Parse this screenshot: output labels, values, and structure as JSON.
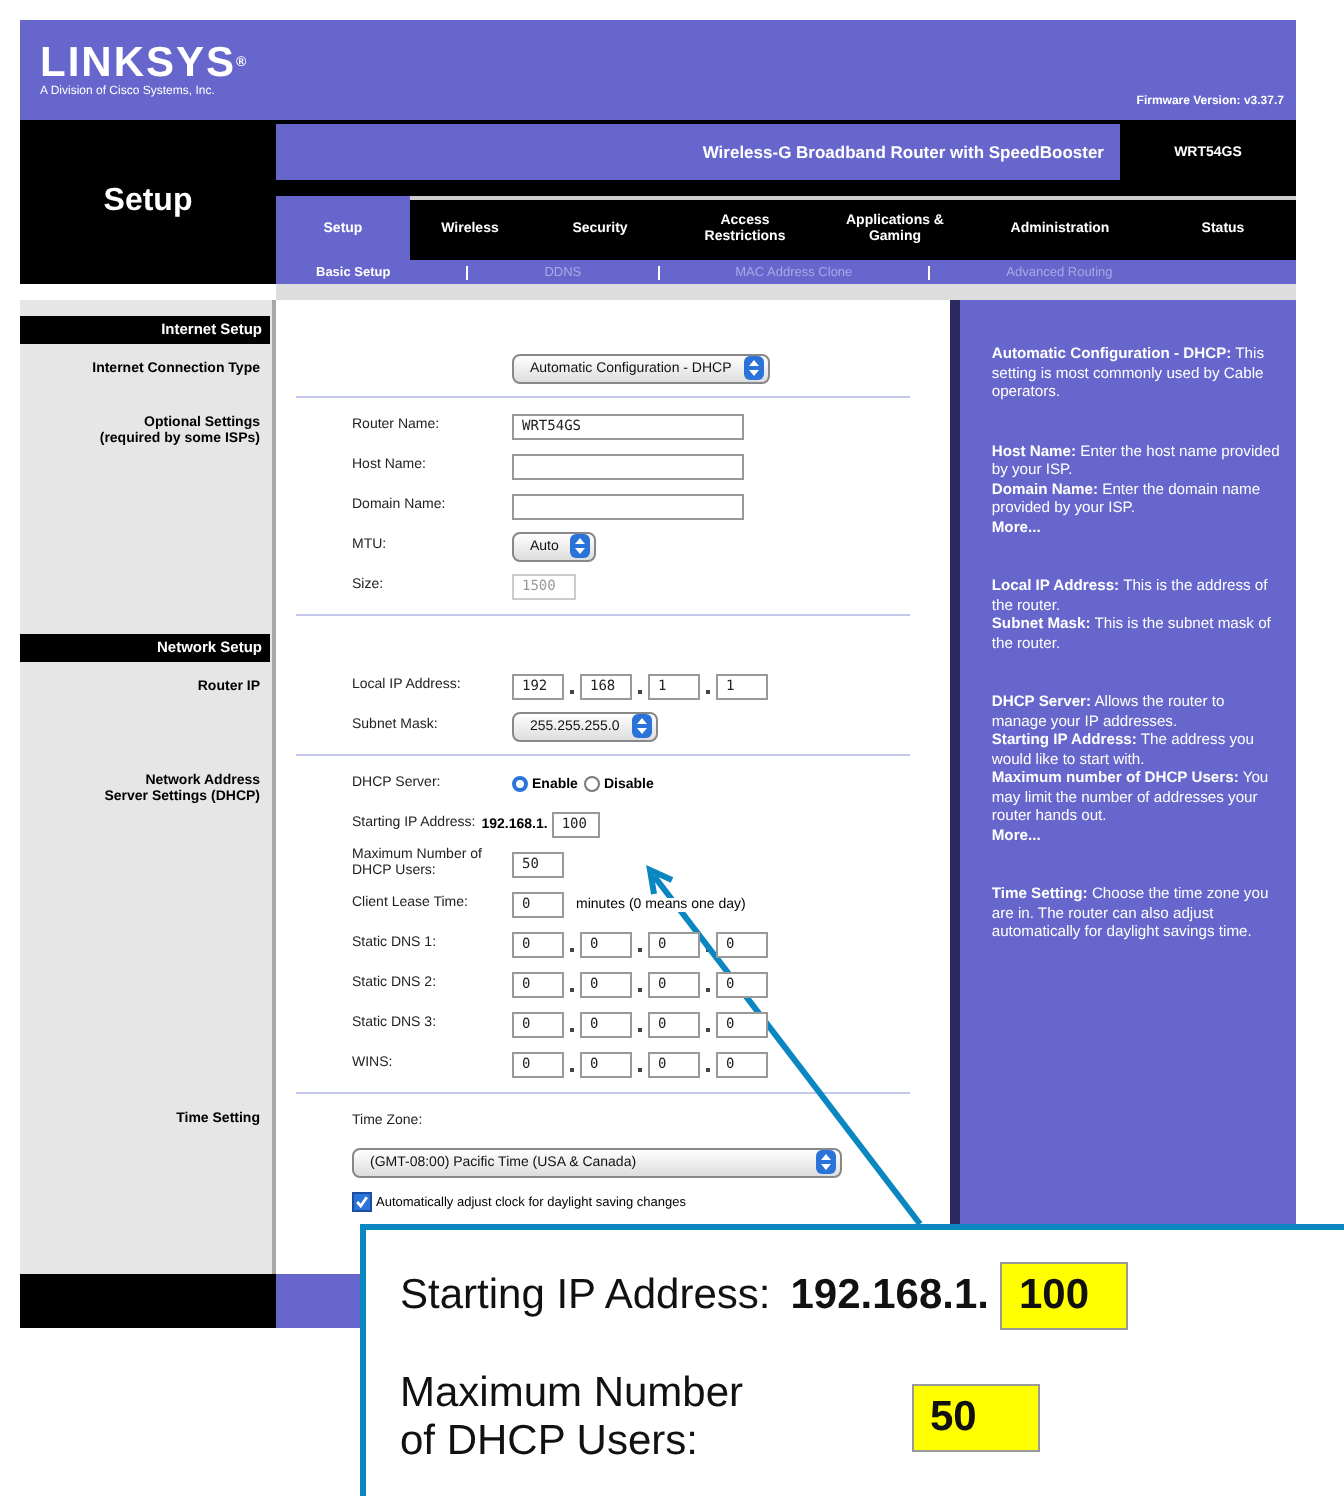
{
  "header": {
    "brand": "LINKSYS$^{®}$",
    "tagline": "A Division of Cisco Systems, Inc.",
    "firmware": "Firmware Version: v3.37.7"
  },
  "nav": {
    "page_title": "Setup",
    "product_title": "Wireless-G Broadband Router with SpeedBooster",
    "model": "WRT54GS",
    "tabs": [
      {
        "label": "Setup",
        "selected": true
      },
      {
        "label": "Wireless",
        "selected": false
      },
      {
        "label": "Security",
        "selected": false
      },
      {
        "label": "Access Restrictions",
        "selected": false
      },
      {
        "label": "Applications & Gaming",
        "selected": false
      },
      {
        "label": "Administration",
        "selected": false
      },
      {
        "label": "Status",
        "selected": false
      }
    ],
    "subtabs": [
      {
        "label": "Basic Setup",
        "selected": true
      },
      {
        "label": "DDNS",
        "selected": false
      },
      {
        "label": "MAC Address Clone",
        "selected": false
      },
      {
        "label": "Advanced Routing",
        "selected": false
      }
    ]
  },
  "sections": [
    {
      "title": "Internet Setup",
      "groups": [
        {
          "label": "Internet Connection Type",
          "rows": [
            {
              "kind": "select",
              "value": "Automatic Configuration - DHCP"
            }
          ]
        },
        {
          "label": "Optional Settings",
          "sublabel": "(required by some ISPs)",
          "rows": [
            {
              "kind": "text",
              "label": "Router Name:",
              "value": "WRT54GS"
            },
            {
              "kind": "text",
              "label": "Host Name:"
            },
            {
              "kind": "text",
              "label": "Domain Name:"
            },
            {
              "kind": "select",
              "label": "MTU:",
              "value": "Auto"
            },
            {
              "kind": "number",
              "label": "Size:",
              "value": "1500",
              "disabled": true
            }
          ]
        }
      ]
    },
    {
      "title": "Network Setup",
      "groups": [
        {
          "label": "Router IP",
          "rows": [
            {
              "kind": "ip",
              "label": "Local IP Address:",
              "octets": [
                "192",
                "168",
                "1",
                "1"
              ]
            },
            {
              "kind": "select",
              "label": "Subnet Mask:",
              "value": "255.255.255.0"
            }
          ]
        },
        {
          "label": "Network Address",
          "sublabel": "Server Settings (DHCP)",
          "rows": [
            {
              "kind": "radio",
              "label": "DHCP Server:",
              "options": [
                {
                  "label": "Enable",
                  "selected": true
                },
                {
                  "label": "Disable",
                  "selected": false
                }
              ]
            },
            {
              "kind": "prefix",
              "label": "Starting IP Address:",
              "prefix": "192.168.1.",
              "value": "100"
            },
            {
              "kind": "number",
              "label": "Maximum Number of DHCP Users:",
              "value": "50"
            },
            {
              "kind": "number",
              "label": "Client Lease Time:",
              "value": "0",
              "suffix": "minutes (0 means one day)"
            },
            {
              "kind": "ip",
              "label": "Static DNS 1:",
              "octets": [
                "0",
                "0",
                "0",
                "0"
              ]
            },
            {
              "kind": "ip",
              "label": "Static DNS 2:",
              "octets": [
                "0",
                "0",
                "0",
                "0"
              ]
            },
            {
              "kind": "ip",
              "label": "Static DNS 3:",
              "octets": [
                "0",
                "0",
                "0",
                "0"
              ]
            },
            {
              "kind": "ip",
              "label": "WINS:",
              "octets": [
                "0",
                "0",
                "0",
                "0"
              ]
            }
          ]
        },
        {
          "label": "Time Setting",
          "rows": [
            {
              "kind": "caption",
              "label": "Time Zone:"
            },
            {
              "kind": "select",
              "value": "(GMT-08:00) Pacific Time (USA & Canada)",
              "wide": true
            },
            {
              "kind": "checkbox",
              "label": "Automatically adjust clock for daylight saving changes",
              "checked": true
            }
          ]
        }
      ]
    }
  ],
  "help": [
    [
      {
        "kind": "text",
        "text": "**Automatic Configuration - DHCP:** This setting is most commonly used by Cable operators."
      }
    ],
    [
      {
        "kind": "text",
        "text": "**Host Name:** Enter the host name provided by your ISP."
      },
      {
        "kind": "text",
        "text": "**Domain Name:** Enter the domain name provided by your ISP."
      },
      {
        "kind": "link",
        "text": "More..."
      }
    ],
    [
      {
        "kind": "text",
        "text": "**Local IP Address:** This is the address of the router."
      },
      {
        "kind": "text",
        "text": "**Subnet Mask:** This is the subnet mask of the router."
      }
    ],
    [
      {
        "kind": "text",
        "text": "**DHCP Server:** Allows the router to manage your IP addresses."
      },
      {
        "kind": "text",
        "text": "**Starting IP Address:** The address you would like to start with."
      },
      {
        "kind": "text",
        "text": "**Maximum number of DHCP Users:** You may limit the number of addresses your router hands out."
      },
      {
        "kind": "link",
        "text": "More..."
      }
    ],
    [
      {
        "kind": "text",
        "text": "**Time Setting:** Choose the time zone you are in. The router can also adjust automatically for daylight savings time."
      }
    ]
  ],
  "callout": {
    "rows": [
      {
        "label": "Starting IP Address:",
        "prefix": "192.168.1.",
        "value": "100"
      },
      {
        "label": "Maximum Number of DHCP Users:",
        "value": "50"
      }
    ]
  }
}
